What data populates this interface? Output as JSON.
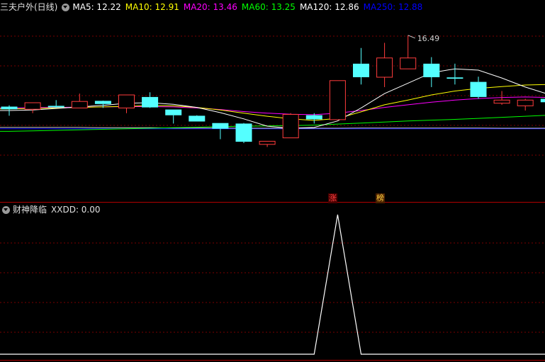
{
  "main_header": {
    "title": "三夫户外(日线)",
    "ma": [
      {
        "label": "MA5: 12.22",
        "color": "#ffffff"
      },
      {
        "label": "MA10: 12.91",
        "color": "#ffff00"
      },
      {
        "label": "MA20: 13.46",
        "color": "#ff00ff"
      },
      {
        "label": "MA60: 13.25",
        "color": "#00ff00"
      },
      {
        "label": "MA120: 12.86",
        "color": "#ffffff"
      },
      {
        "label": "MA250: 12.88",
        "color": "#0000ff"
      }
    ]
  },
  "sub_header": {
    "title": "财神降临",
    "value_label": "XXDD: 0.00"
  },
  "markers": {
    "zhang": "涨",
    "bang": "榜"
  },
  "colors": {
    "up": "#ff3c3c",
    "down": "#54ffff",
    "grid": "#7a0000",
    "border": "#b00000"
  },
  "chart_data": [
    {
      "type": "candlestick",
      "high_label": "16.49",
      "ylim": [
        10.5,
        17.3
      ],
      "candles": [
        {
          "o": 13.75,
          "c": 13.65,
          "h": 13.8,
          "l": 13.4
        },
        {
          "o": 13.65,
          "c": 13.9,
          "h": 13.9,
          "l": 13.5
        },
        {
          "o": 13.78,
          "c": 13.72,
          "h": 14.0,
          "l": 13.7
        },
        {
          "o": 13.7,
          "c": 13.95,
          "h": 14.25,
          "l": 13.7
        },
        {
          "o": 13.97,
          "c": 13.85,
          "h": 13.98,
          "l": 13.7
        },
        {
          "o": 13.7,
          "c": 14.2,
          "h": 14.2,
          "l": 13.5
        },
        {
          "o": 14.12,
          "c": 13.72,
          "h": 14.3,
          "l": 13.7
        },
        {
          "o": 13.64,
          "c": 13.42,
          "h": 13.64,
          "l": 13.1
        },
        {
          "o": 13.4,
          "c": 13.18,
          "h": 13.42,
          "l": 13.18
        },
        {
          "o": 13.12,
          "c": 12.9,
          "h": 13.12,
          "l": 12.5
        },
        {
          "o": 13.1,
          "c": 12.4,
          "h": 13.12,
          "l": 12.35
        },
        {
          "o": 12.3,
          "c": 12.42,
          "h": 12.42,
          "l": 12.2
        },
        {
          "o": 12.55,
          "c": 13.45,
          "h": 13.5,
          "l": 12.55
        },
        {
          "o": 13.42,
          "c": 13.26,
          "h": 13.5,
          "l": 13.1
        },
        {
          "o": 13.25,
          "c": 14.75,
          "h": 14.75,
          "l": 13.25
        },
        {
          "o": 15.4,
          "c": 14.88,
          "h": 16.0,
          "l": 14.6
        },
        {
          "o": 14.88,
          "c": 15.62,
          "h": 16.2,
          "l": 14.5
        },
        {
          "o": 15.2,
          "c": 15.62,
          "h": 16.49,
          "l": 15.2
        },
        {
          "o": 15.4,
          "c": 14.88,
          "h": 15.65,
          "l": 14.5
        },
        {
          "o": 14.87,
          "c": 14.82,
          "h": 15.4,
          "l": 14.6
        },
        {
          "o": 14.7,
          "c": 14.12,
          "h": 14.9,
          "l": 14.05
        },
        {
          "o": 13.88,
          "c": 14.0,
          "h": 14.35,
          "l": 13.82
        },
        {
          "o": 13.78,
          "c": 14.0,
          "h": 14.05,
          "l": 13.6
        },
        {
          "o": 14.05,
          "c": 13.92,
          "h": 14.3,
          "l": 13.85
        }
      ],
      "ma5": [
        13.6,
        13.62,
        13.68,
        13.74,
        13.8,
        13.88,
        13.9,
        13.84,
        13.72,
        13.52,
        13.28,
        13.0,
        12.92,
        12.95,
        13.2,
        13.7,
        14.25,
        14.65,
        15.05,
        15.2,
        15.15,
        14.85,
        14.5,
        14.22
      ],
      "ma10": [
        13.66,
        13.68,
        13.7,
        13.72,
        13.74,
        13.76,
        13.79,
        13.78,
        13.72,
        13.62,
        13.5,
        13.38,
        13.28,
        13.22,
        13.3,
        13.55,
        13.82,
        14.0,
        14.2,
        14.35,
        14.45,
        14.52,
        14.58,
        14.6
      ],
      "ma20": [
        13.7,
        13.71,
        13.72,
        13.73,
        13.74,
        13.75,
        13.75,
        13.74,
        13.7,
        13.64,
        13.56,
        13.5,
        13.46,
        13.44,
        13.5,
        13.6,
        13.72,
        13.82,
        13.92,
        14.0,
        14.06,
        14.1,
        14.12,
        14.1
      ],
      "ma60": [
        12.8,
        12.82,
        12.84,
        12.86,
        12.88,
        12.9,
        12.92,
        12.94,
        12.96,
        12.98,
        13.0,
        13.01,
        13.02,
        13.04,
        13.08,
        13.12,
        13.16,
        13.2,
        13.23,
        13.26,
        13.3,
        13.34,
        13.38,
        13.42
      ],
      "ma120": [
        12.95,
        12.95,
        12.95,
        12.95,
        12.94,
        12.94,
        12.94,
        12.93,
        12.93,
        12.93,
        12.92,
        12.92,
        12.92,
        12.92,
        12.92,
        12.93,
        12.93,
        12.93,
        12.93,
        12.93,
        12.93,
        12.92,
        12.92,
        12.92
      ],
      "ma250": [
        12.9,
        12.9,
        12.9,
        12.9,
        12.9,
        12.9,
        12.9,
        12.9,
        12.9,
        12.9,
        12.9,
        12.9,
        12.9,
        12.9,
        12.9,
        12.9,
        12.9,
        12.9,
        12.9,
        12.9,
        12.9,
        12.9,
        12.9,
        12.9
      ]
    },
    {
      "type": "line",
      "series": [
        {
          "name": "XXDD",
          "values": [
            0,
            0,
            0,
            0,
            0,
            0,
            0,
            0,
            0,
            0,
            0,
            0,
            0,
            0,
            1,
            0,
            0,
            0,
            0,
            0,
            0,
            0,
            0,
            0
          ]
        }
      ],
      "ylim": [
        0,
        1
      ]
    }
  ]
}
